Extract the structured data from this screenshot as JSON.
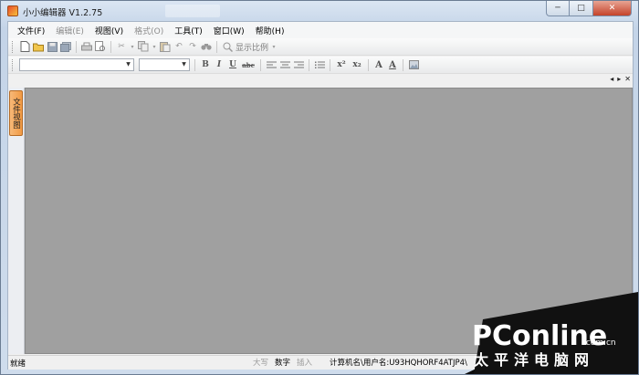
{
  "window": {
    "title": "小小编辑器 V1.2.75",
    "controls": {
      "minimize": "─",
      "maximize": "□",
      "close": "✕"
    }
  },
  "menu": [
    {
      "label": "文件(F)",
      "enabled": true
    },
    {
      "label": "编辑(E)",
      "enabled": false
    },
    {
      "label": "视图(V)",
      "enabled": true
    },
    {
      "label": "格式(O)",
      "enabled": false
    },
    {
      "label": "工具(T)",
      "enabled": true
    },
    {
      "label": "窗口(W)",
      "enabled": true
    },
    {
      "label": "帮助(H)",
      "enabled": true
    }
  ],
  "toolbar": {
    "zoom_label": "显示比例",
    "font_name_value": "",
    "font_size_value": "",
    "format_buttons": [
      "B",
      "I",
      "U",
      "abc",
      "x²",
      "x₂",
      "A",
      "A"
    ]
  },
  "tab_nav": {
    "prev": "◂",
    "next": "▸",
    "close": "✕"
  },
  "side_panel": {
    "tab_label": "文件视图"
  },
  "status": {
    "ready": "就绪",
    "caps": "大写",
    "num": "数字",
    "insert": "插入",
    "computer_user": "计算机名\\用户名:U93HQHORF4ATJP4\\"
  },
  "watermark": {
    "brand": "PConline",
    "domain": ".com.cn",
    "cn": "太平洋电脑网"
  }
}
